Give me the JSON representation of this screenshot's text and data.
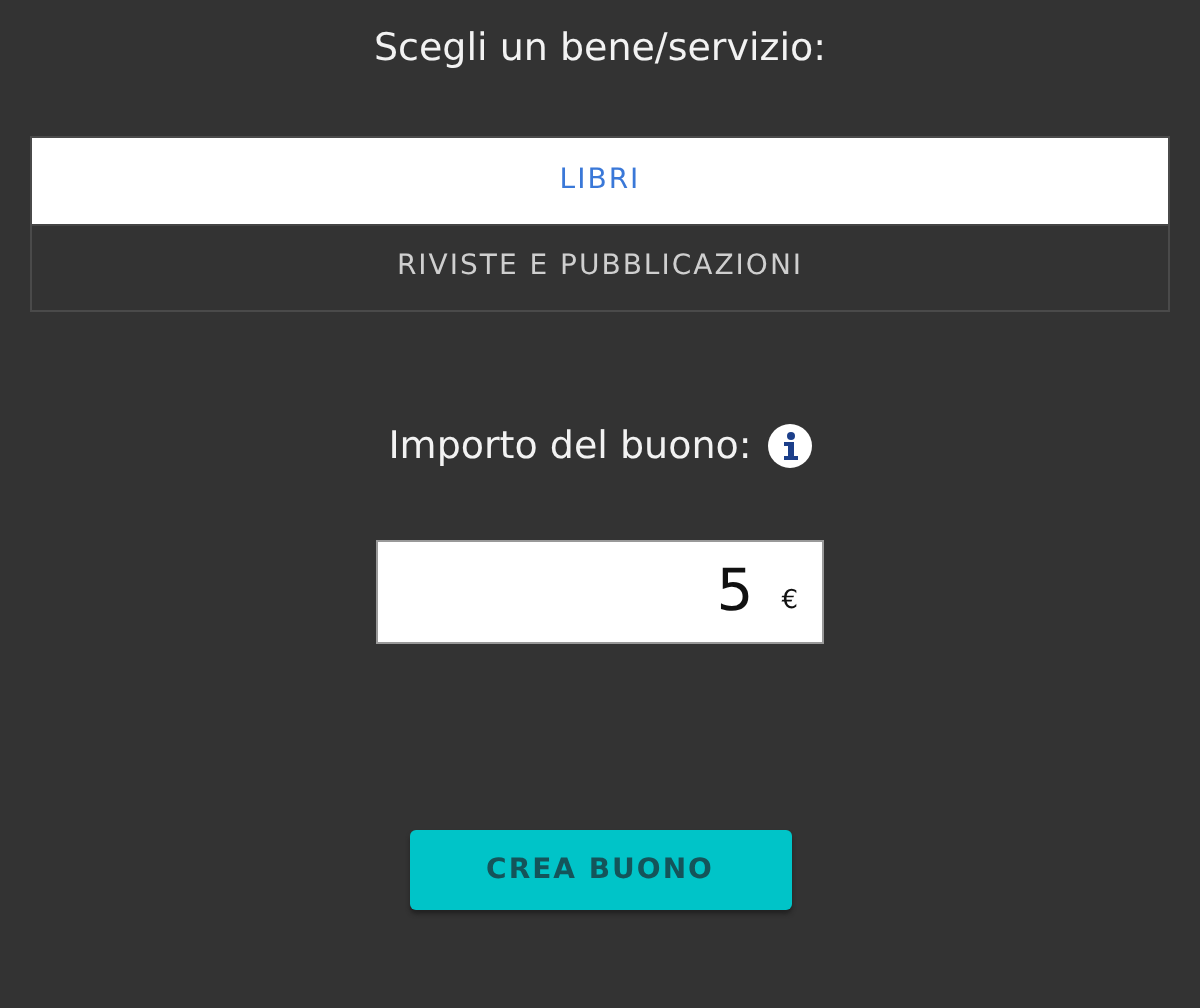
{
  "heading": "Scegli un bene/servizio:",
  "options": [
    {
      "label": "LIBRI",
      "selected": true
    },
    {
      "label": "RIVISTE E PUBBLICAZIONI",
      "selected": false
    }
  ],
  "amount": {
    "label": "Importo del buono:",
    "value": "5",
    "currency": "€"
  },
  "button": "CREA BUONO"
}
